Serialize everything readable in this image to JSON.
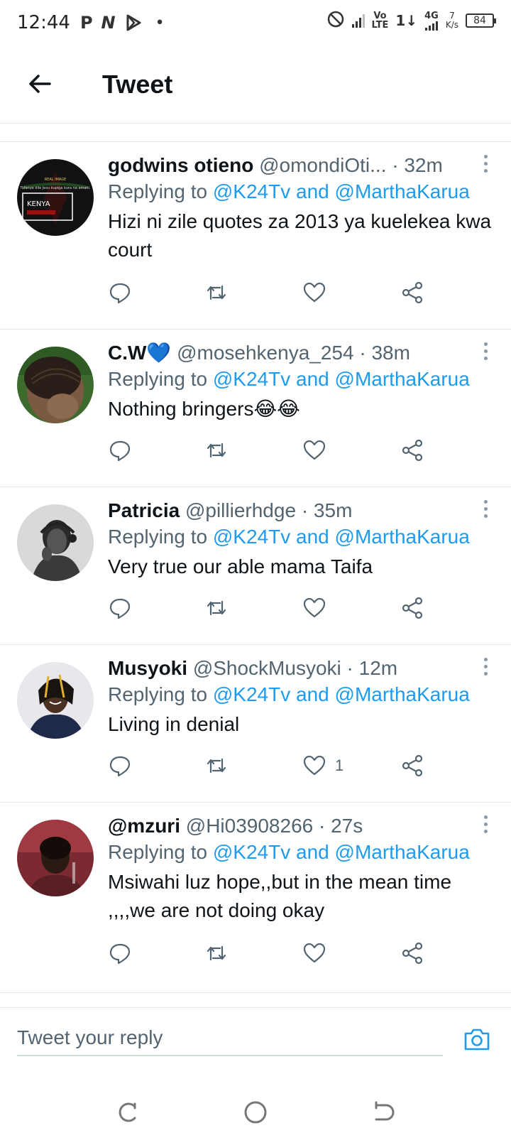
{
  "status_bar": {
    "time": "12:44",
    "notification_icons": [
      "P",
      "N",
      "play-protect"
    ],
    "dot": "•",
    "network_volte": "Vo\nLTE",
    "network_4g": "4G",
    "speed_value": "7",
    "speed_unit": "K/s",
    "battery": "84"
  },
  "header": {
    "title": "Tweet",
    "back_icon": "arrow-left-icon"
  },
  "colors": {
    "accent": "#1d9bf0",
    "secondary_text": "#536471",
    "primary_text": "#0f1419"
  },
  "tweets": [
    {
      "name": "godwins otieno",
      "handle": "@omondiOti...",
      "time": "32m",
      "replying_prefix": "Replying to",
      "mention1": "@K24Tv",
      "and_word": "and",
      "mention2": "@MarthaKarua",
      "text": "Hizi ni zile quotes za 2013 ya kuelekea kwa court",
      "like_count": ""
    },
    {
      "name": "C.W💙",
      "handle": "@mosehkenya_254",
      "time": "38m",
      "replying_prefix": "Replying to",
      "mention1": "@K24Tv",
      "and_word": "and",
      "mention2": "@MarthaKarua",
      "text": "Nothing bringers😂😂",
      "like_count": ""
    },
    {
      "name": "Patricia",
      "handle": "@pillierhdge",
      "time": "35m",
      "replying_prefix": "Replying to",
      "mention1": "@K24Tv",
      "and_word": "and",
      "mention2": "@MarthaKarua",
      "text": "Very true our able mama Taifa",
      "like_count": ""
    },
    {
      "name": "Musyoki",
      "handle": "@ShockMusyoki",
      "time": "12m",
      "replying_prefix": "Replying to",
      "mention1": "@K24Tv",
      "and_word": "and",
      "mention2": "@MarthaKarua",
      "text": "Living in denial",
      "like_count": "1"
    },
    {
      "name": "@mzuri",
      "handle": "@Hi03908266",
      "time": "27s",
      "replying_prefix": "Replying to",
      "mention1": "@K24Tv",
      "and_word": "and",
      "mention2": "@MarthaKarua",
      "text": "Msiwahi luz hope,,but in the mean time ,,,,we are not doing okay",
      "like_count": ""
    }
  ],
  "avatar_1_text": {
    "line1": "REAL IMAGE",
    "line2": "Tufanye kile Jesu kupiga kura na amani.",
    "label": "KENYA"
  },
  "reply_bar": {
    "placeholder": "Tweet your reply",
    "camera_icon": "camera-icon"
  },
  "nav_bar": {
    "icons": [
      "recents-icon",
      "home-icon",
      "back-icon"
    ]
  }
}
